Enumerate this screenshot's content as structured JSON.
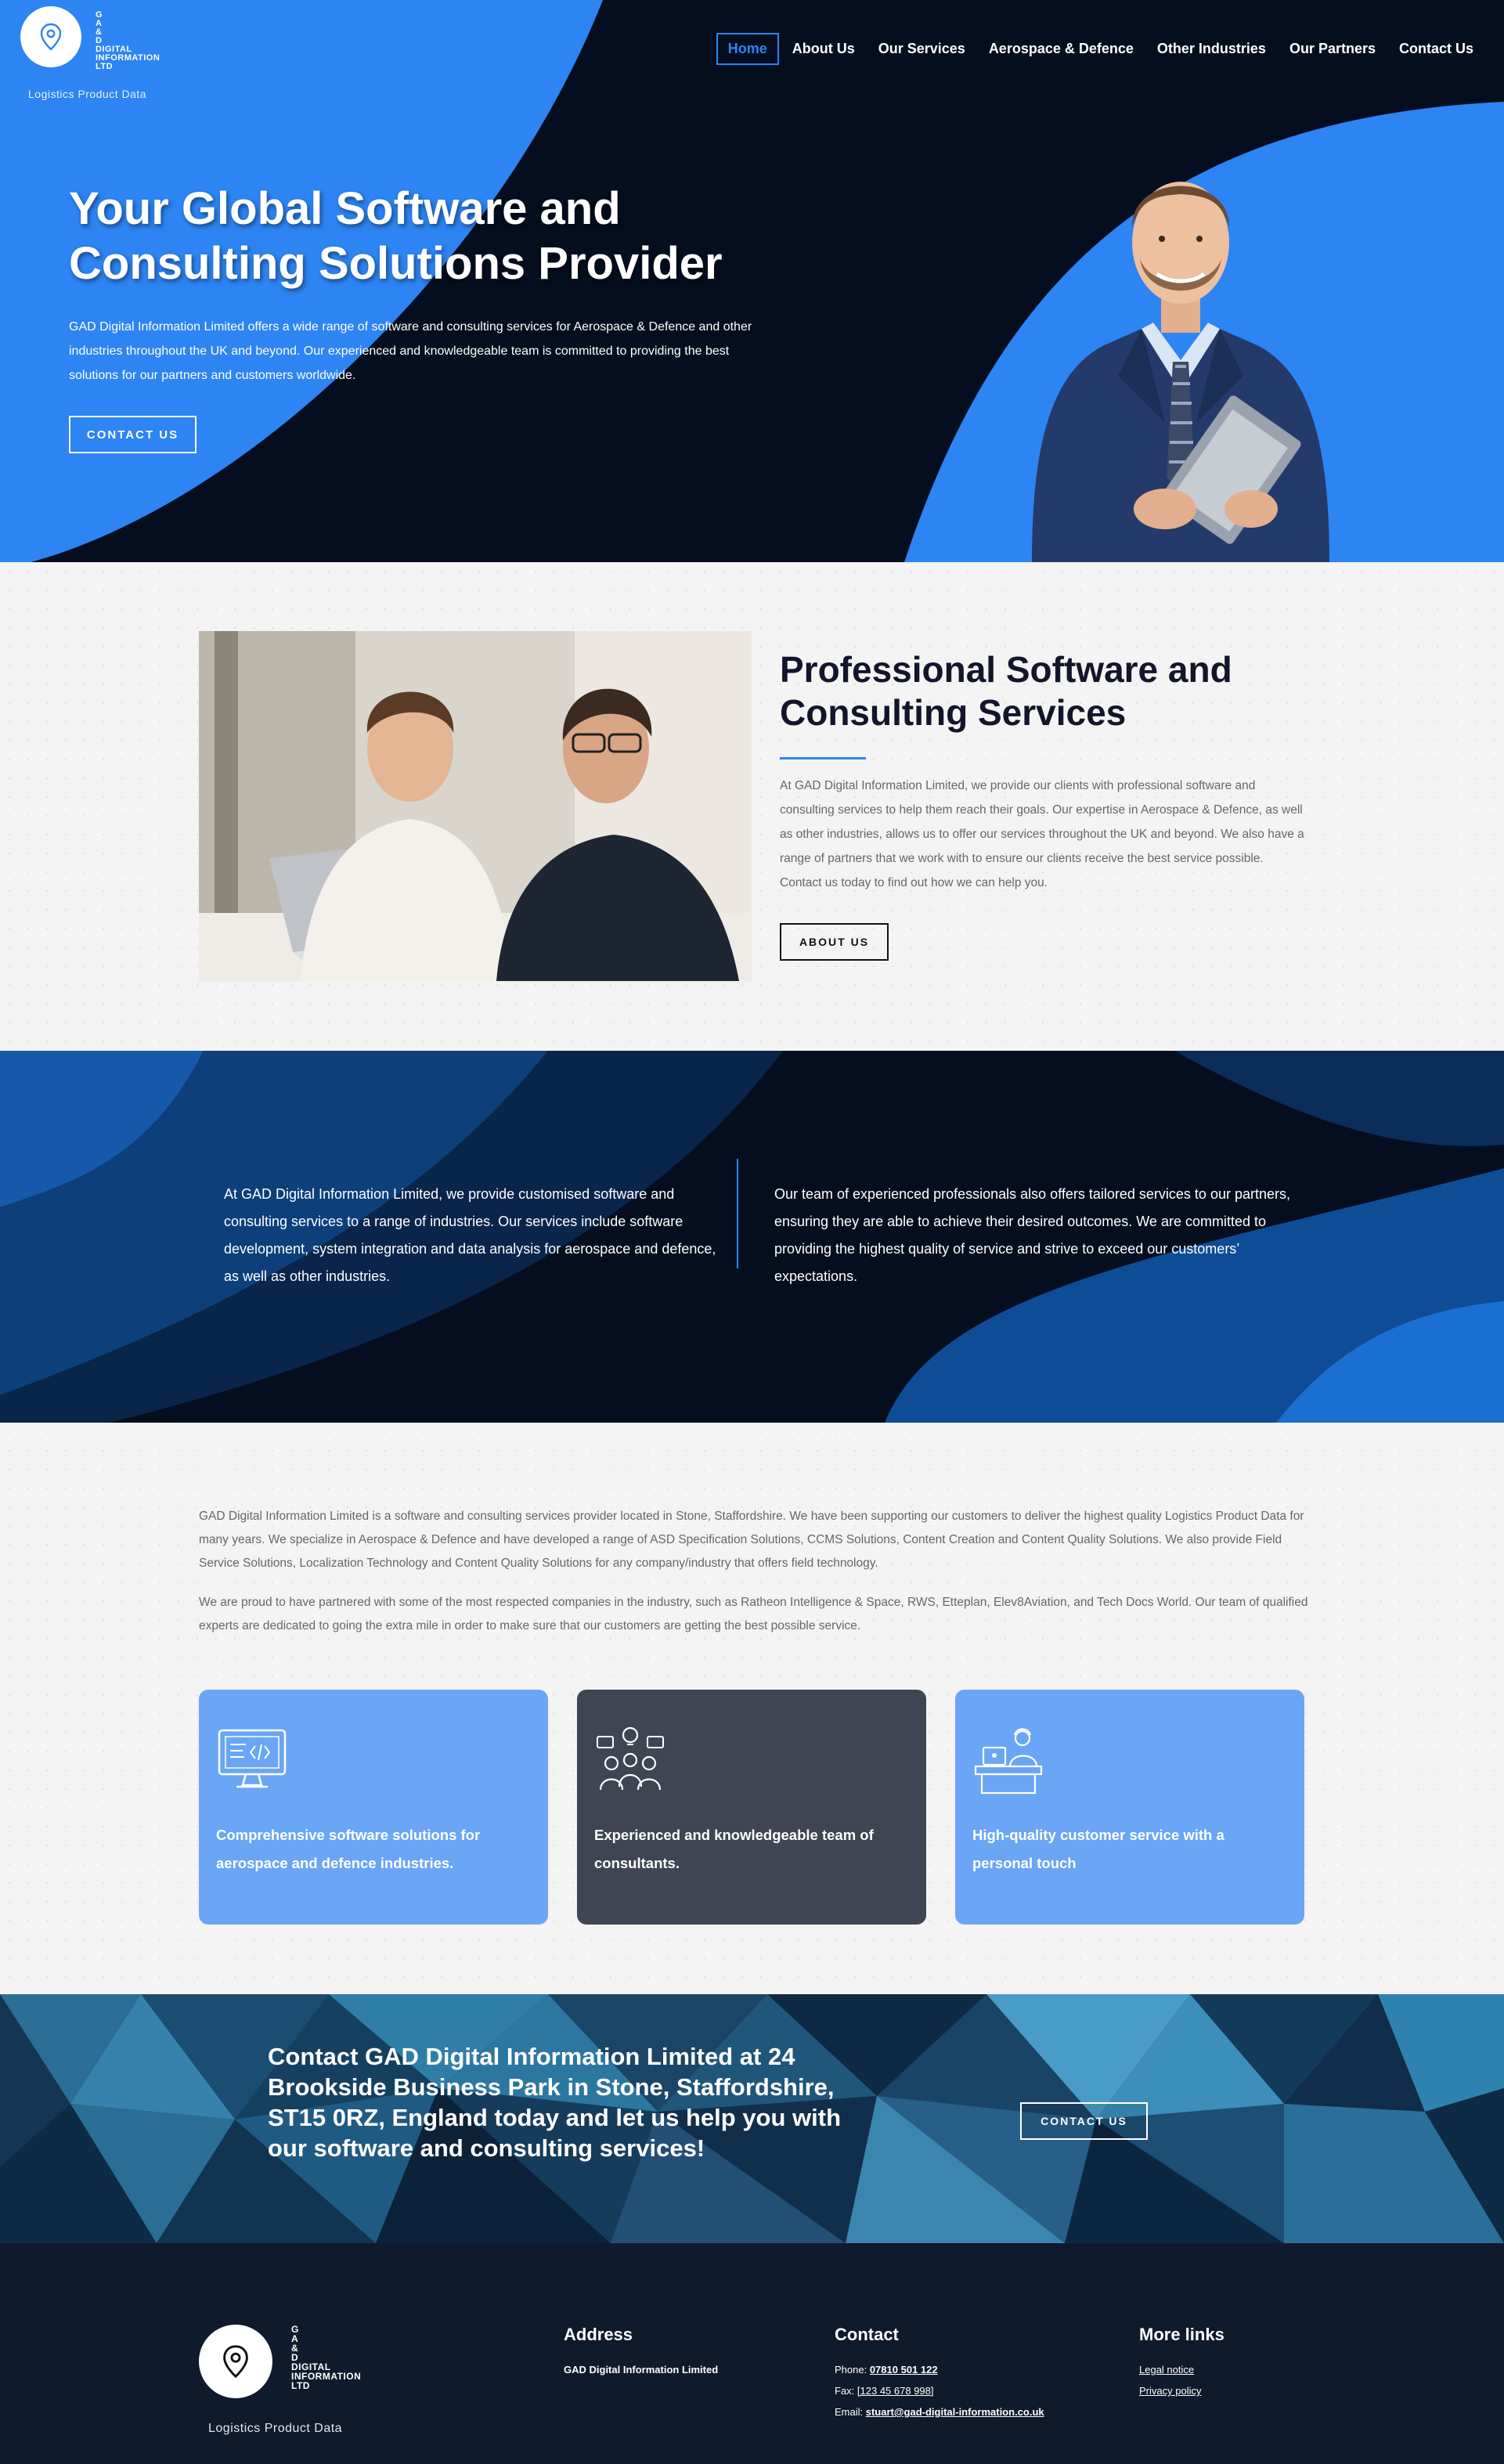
{
  "brand": {
    "name_lines": [
      "G",
      "A",
      "&",
      "D",
      "DIGITAL",
      "INFORMATION",
      "LTD"
    ],
    "tagline": "Logistics Product Data"
  },
  "nav": {
    "items": [
      "Home",
      "About Us",
      "Our Services",
      "Aerospace & Defence",
      "Other Industries",
      "Our Partners",
      "Contact Us"
    ],
    "active": "Home"
  },
  "hero": {
    "title": "Your Global Software and Consulting Solutions Provider",
    "description": "GAD Digital Information Limited offers a wide range of software and consulting services for Aerospace & Defence and other industries throughout the UK and beyond. Our experienced and knowledgeable team is committed to providing the best solutions for our partners and customers worldwide.",
    "button": "CONTACT US"
  },
  "about": {
    "title": "Professional Software and Consulting Services",
    "text": "At GAD Digital Information Limited, we provide our clients with professional software and consulting services to help them reach their goals. Our expertise in Aerospace & Defence, as well as other industries, allows us to offer our services throughout the UK and beyond. We also have a range of partners that we work with to ensure our clients receive the best service possible. Contact us today to find out how we can help you.",
    "button": "ABOUT US"
  },
  "services": {
    "left": "At GAD Digital Information Limited, we provide customised software and consulting services to a range of industries. Our services include software development, system integration and data analysis for aerospace and defence, as well as other industries.",
    "right": "Our team of experienced professionals also offers tailored services to our partners, ensuring they are able to achieve their desired outcomes. We are committed to providing the highest quality of service and strive to exceed our customers’ expectations."
  },
  "intro": {
    "p1": "GAD Digital Information Limited is a software and consulting services provider located in Stone, Staffordshire. We have been supporting our customers to deliver the highest quality Logistics Product Data for many years. We specialize in Aerospace & Defence and have developed a range of ASD Specification Solutions, CCMS Solutions, Content Creation and Content Quality Solutions. We also provide Field Service Solutions, Localization Technology and Content Quality Solutions for any company/industry that offers field technology.",
    "p2": "We are proud to have partnered with some of the most respected companies in the industry, such as Ratheon Intelligence & Space, RWS, Etteplan, Elev8Aviation, and Tech Docs World. Our team of qualified experts are dedicated to going the extra mile in order to make sure that our customers are getting the best possible service."
  },
  "cards": [
    {
      "text": "Comprehensive software solutions for aerospace and defence industries.",
      "icon": "computer-code-icon",
      "color": "#6aa6f5"
    },
    {
      "text": "Experienced and knowledgeable team of consultants.",
      "icon": "team-idea-icon",
      "color": "#3f4553"
    },
    {
      "text": "High-quality customer service with a personal touch",
      "icon": "service-desk-icon",
      "color": "#6aa6f5"
    }
  ],
  "contact_band": {
    "title": "Contact GAD Digital Information Limited at 24 Brookside Business Park in Stone, Staffordshire, ST15 0RZ, England today and let us help you with our software and consulting services!",
    "button": "CONTACT US"
  },
  "footer": {
    "address": {
      "heading": "Address",
      "line": "GAD Digital Information Limited"
    },
    "contact": {
      "heading": "Contact",
      "phone_label": "Phone: ",
      "phone": "07810 501 122",
      "fax_label": "Fax: ",
      "fax": "[123 45 678 998]",
      "email_label": "Email: ",
      "email": "stuart@gad-digital-information.co.uk"
    },
    "links": {
      "heading": "More links",
      "items": [
        "Legal notice",
        "Privacy policy"
      ]
    }
  },
  "colors": {
    "accent": "#2d84f3",
    "navy": "#050e1f",
    "card_blue": "#6aa6f5",
    "card_dark": "#3f4553",
    "footer": "#0f1a2d"
  }
}
